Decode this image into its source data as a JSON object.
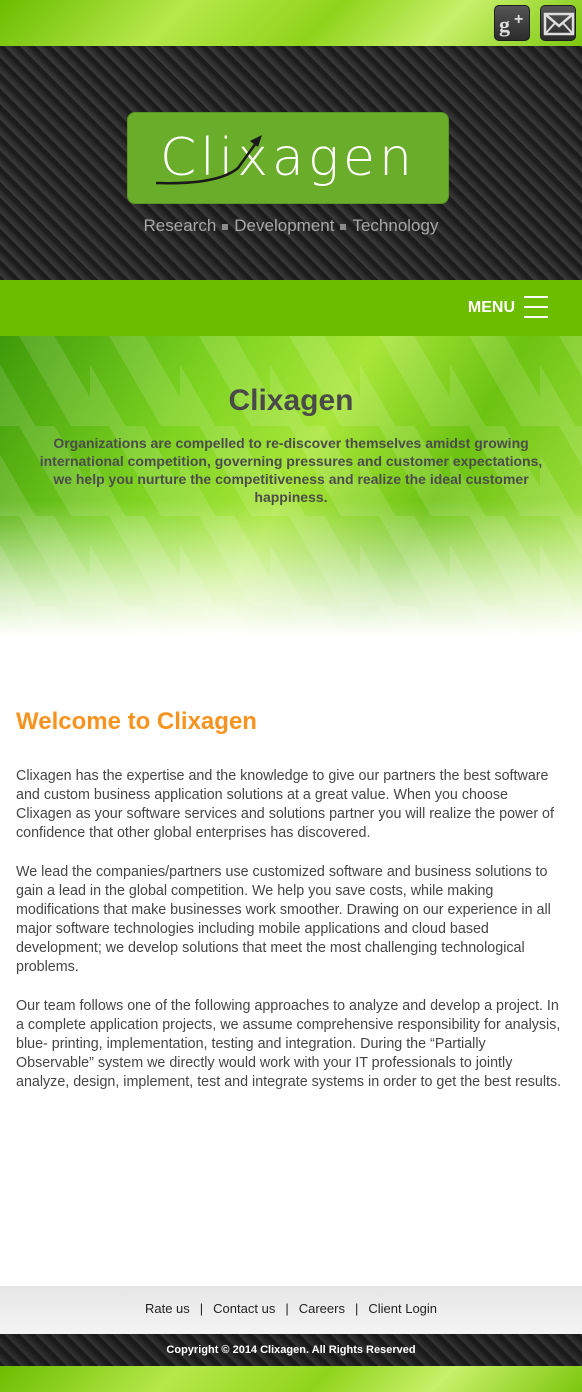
{
  "social": {
    "gplus_icon": "google-plus-icon",
    "mail_icon": "mail-icon"
  },
  "header": {
    "logo_text": "Clixagen",
    "tagline": [
      "Research",
      "Development",
      "Technology"
    ]
  },
  "nav": {
    "menu_label": "MENU",
    "menu_icon": "hamburger-icon"
  },
  "hero": {
    "title": "Clixagen",
    "text": "Organizations are compelled to re-discover themselves amidst growing international competition, governing pressures and customer expectations, we help you nurture the competitiveness and realize the ideal customer happiness."
  },
  "main": {
    "heading": "Welcome to Clixagen",
    "paragraphs": [
      "Clixagen has the expertise and the knowledge to give our partners the best software and custom business application solutions at a great value. When you choose Clixagen as your software services and solutions partner you will realize the power of confidence that other global enterprises has discovered.",
      "We lead the companies/partners use customized software and business solutions to gain a lead in the global competition. We help you save costs, while making modifications that make businesses work smoother. Drawing on our experience in all major software technologies including mobile applications and cloud based development; we develop solutions that meet the most challenging technological problems.",
      "Our team follows one of the following approaches to analyze and develop a project. In a complete application projects, we assume comprehensive responsibility for analysis, blue- printing, implementation, testing and integration. During the “Partially Observable” system we directly would work with your IT professionals to jointly analyze, design, implement, test and integrate systems in order to get the best results."
    ]
  },
  "footer": {
    "links": [
      "Rate us",
      "Contact us",
      "Careers",
      "Client Login"
    ],
    "separator": "|",
    "copyright": "Copyright © 2014 Clixagen. All Rights Reserved"
  },
  "colors": {
    "brand_green": "#6cbc00",
    "accent_orange": "#f7931e",
    "logo_green": "#6aad2a"
  }
}
